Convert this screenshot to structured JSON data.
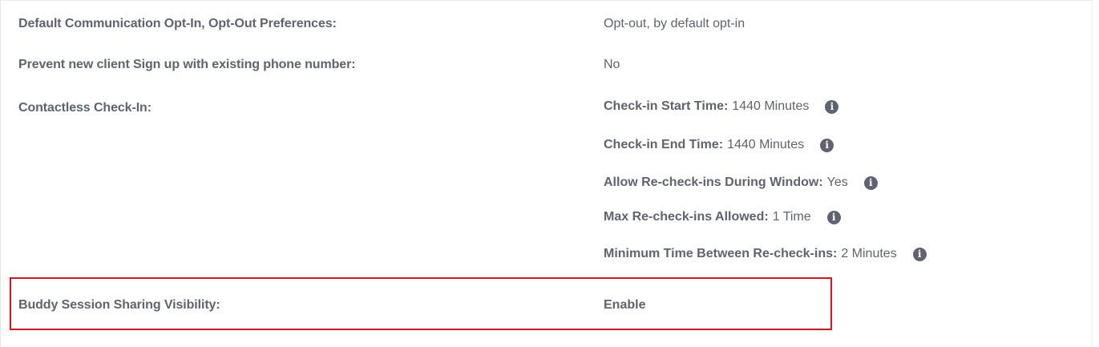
{
  "settings": {
    "optin": {
      "label": "Default Communication Opt-In, Opt-Out Preferences:",
      "value": "Opt-out, by default opt-in"
    },
    "phone": {
      "label": "Prevent new client Sign up with existing phone number:",
      "value": "No"
    },
    "contactless": {
      "label": "Contactless Check-In:",
      "items": [
        {
          "key": "Check-in Start Time:",
          "value": "1440 Minutes"
        },
        {
          "key": "Check-in End Time:",
          "value": "1440 Minutes"
        },
        {
          "key": "Allow Re-check-ins During Window:",
          "value": "Yes"
        },
        {
          "key": "Max Re-check-ins Allowed:",
          "value": "1 Time"
        },
        {
          "key": "Minimum Time Between Re-check-ins:",
          "value": "2 Minutes"
        }
      ]
    },
    "buddy": {
      "label": "Buddy Session Sharing Visibility:",
      "value": "Enable"
    }
  },
  "icons": {
    "info": "info-circle-icon"
  },
  "colors": {
    "text": "#5f6371",
    "highlight_border": "#e0131c"
  }
}
